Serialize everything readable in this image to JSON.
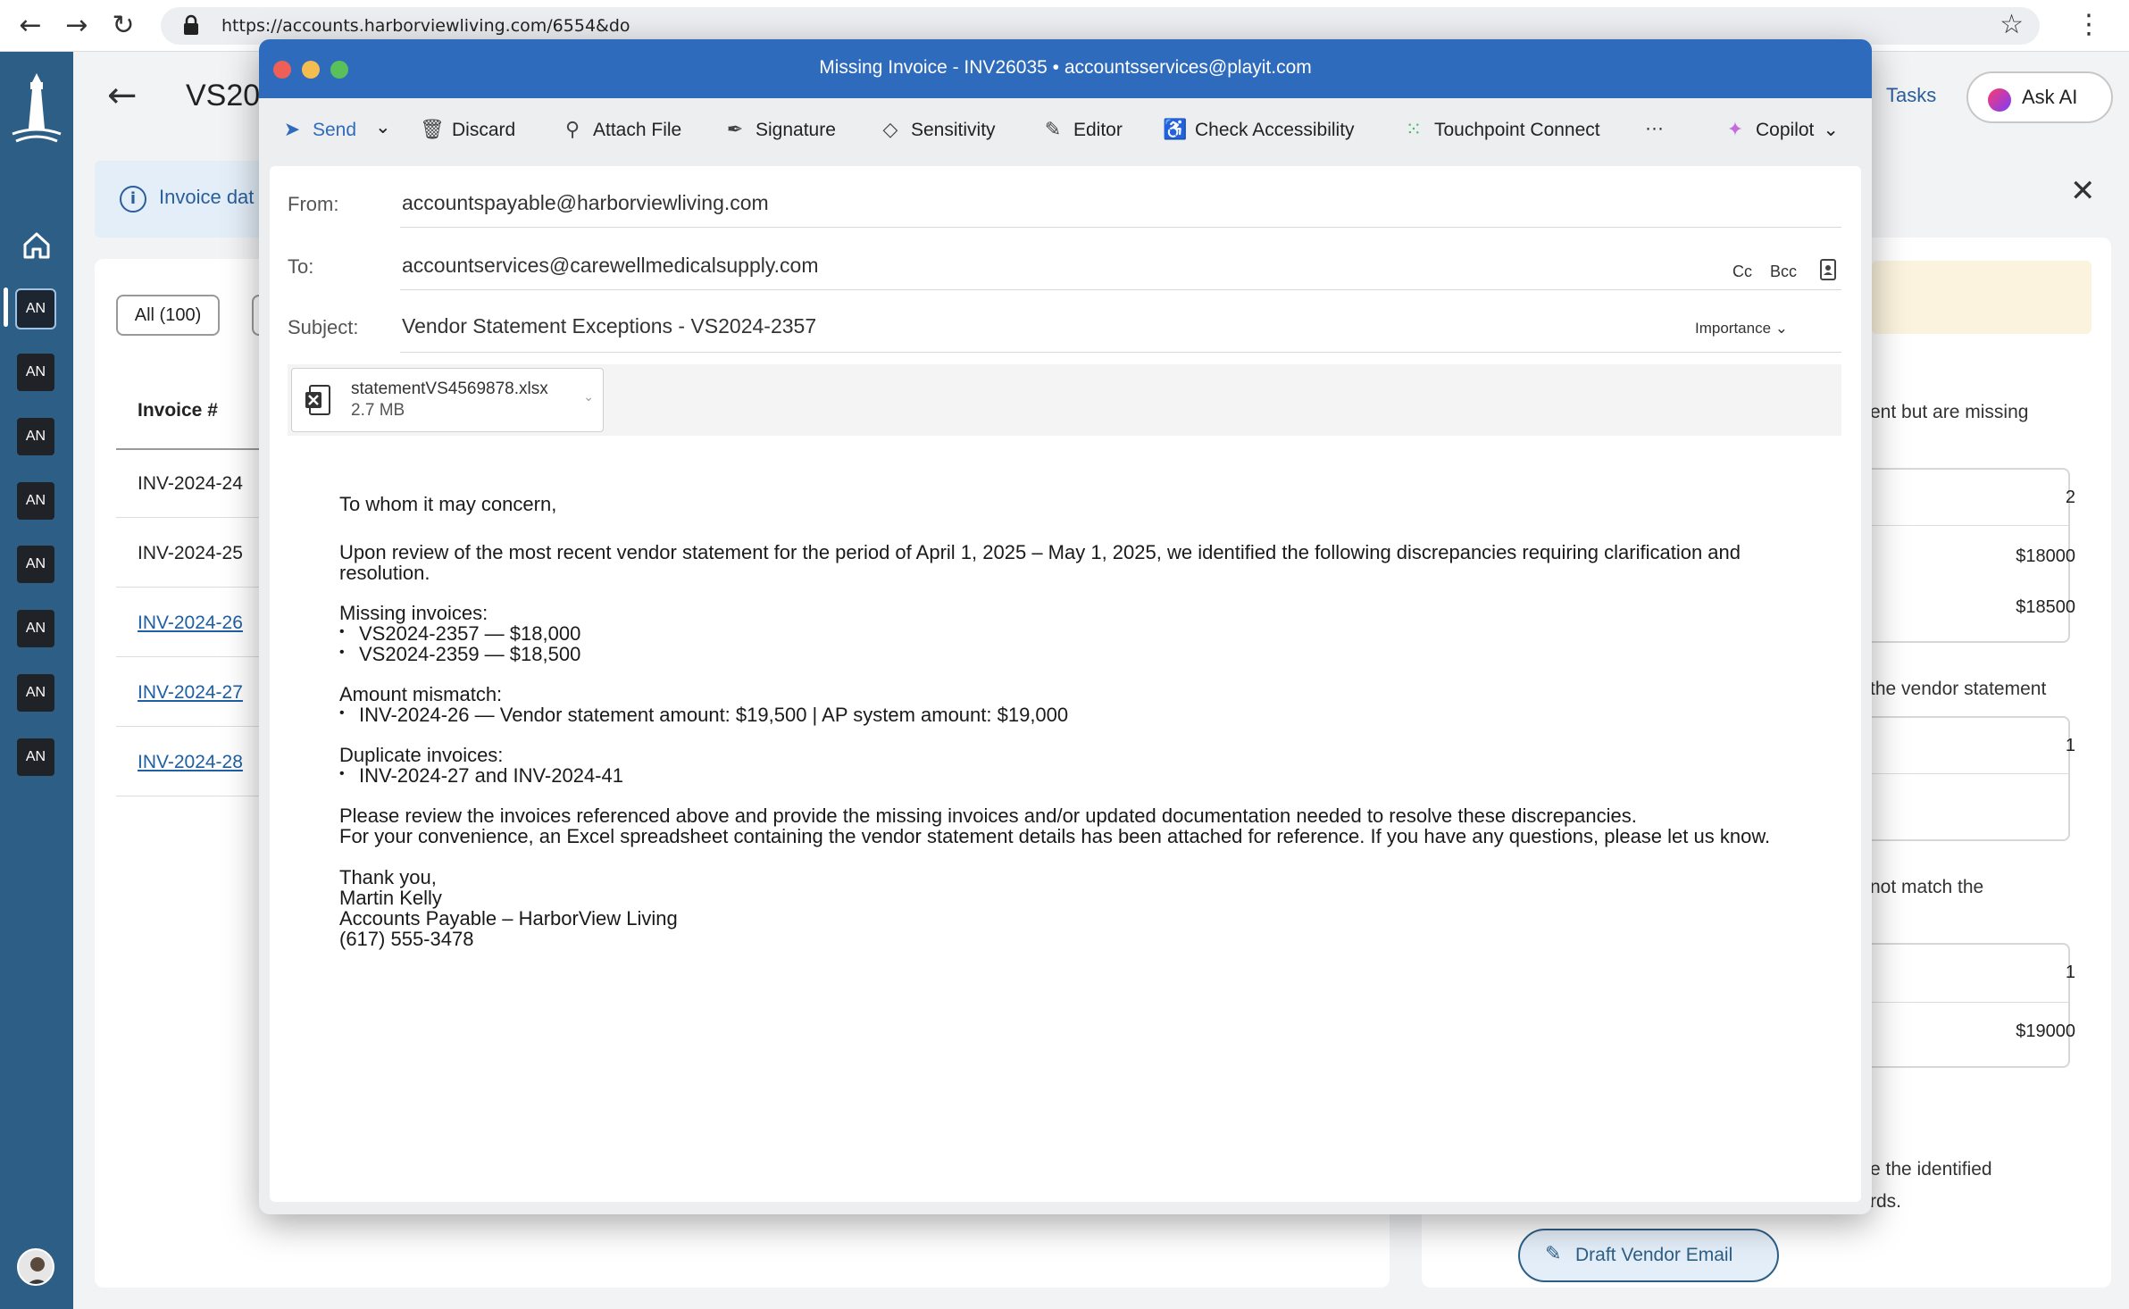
{
  "browser": {
    "url": "https://accounts.harborviewliving.com/6554&do",
    "back": "←",
    "forward": "→",
    "reload": "↻",
    "star": "☆",
    "menu": "⋮"
  },
  "sidebar": {
    "items": [
      "AN",
      "AN",
      "AN",
      "AN",
      "AN",
      "AN",
      "AN",
      "AN"
    ]
  },
  "page": {
    "back": "←",
    "title": "VS20",
    "tasks": "Tasks",
    "ask_ai": "Ask AI",
    "info_text": "Invoice dat",
    "filter_all": "All (100)",
    "column_invoice": "Invoice #",
    "invoices": [
      "INV-2024-24",
      "INV-2024-25",
      "INV-2024-26",
      "INV-2024-27",
      "INV-2024-28"
    ],
    "close": "✕"
  },
  "right_panel": {
    "text1": "ent but are missing",
    "box1": {
      "count": "2",
      "amount1": "$18000",
      "amount2": "$18500"
    },
    "text2": "the vendor statement",
    "box2": {
      "count": "1"
    },
    "text3": "not match the",
    "box3": {
      "count": "1",
      "amount": "$19000"
    },
    "text4a": "e the identified",
    "text4b": "rds.",
    "draft_button": "Draft Vendor Email"
  },
  "compose": {
    "title": "Missing Invoice - INV26035  •  accountsservices@playit.com",
    "toolbar": {
      "send": "Send",
      "discard": "Discard",
      "attach": "Attach File",
      "signature": "Signature",
      "sensitivity": "Sensitivity",
      "editor": "Editor",
      "accessibility": "Check Accessibility",
      "touchpoint": "Touchpoint Connect",
      "more": "···",
      "copilot": "Copilot"
    },
    "from_label": "From:",
    "from_value": "accountspayable@harborviewliving.com",
    "to_label": "To:",
    "to_value": "accountservices@carewellmedicalsupply.com",
    "cc": "Cc",
    "bcc": "Bcc",
    "subject_label": "Subject:",
    "subject_value": "Vendor Statement Exceptions -  VS2024-2357",
    "importance": "Importance",
    "attachment": {
      "name": "statementVS4569878.xlsx",
      "size": "2.7 MB"
    },
    "body": {
      "greeting": "To whom it may concern,",
      "intro1": "Upon review of the most recent vendor statement for the period of April 1, 2025 – May 1, 2025, we identified the following discrepancies requiring clarification and",
      "intro2": "resolution.",
      "missing_heading": "Missing invoices:",
      "missing_items": [
        "VS2024-2357 — $18,000",
        "VS2024-2359 — $18,500"
      ],
      "mismatch_heading": "Amount mismatch:",
      "mismatch_items": [
        "INV-2024-26 — Vendor statement amount: $19,500 | AP system amount: $19,000"
      ],
      "duplicate_heading": "Duplicate invoices:",
      "duplicate_items": [
        "INV-2024-27 and INV-2024-41"
      ],
      "closing1": "Please review the invoices referenced above and provide the missing invoices and/or updated documentation needed to resolve these discrepancies.",
      "closing2": "For your convenience, an Excel spreadsheet containing the vendor statement details has been attached for reference. If you have any questions, please let us know.",
      "signoff": "Thank you,",
      "sig_name": "Martin Kelly",
      "sig_title": "Accounts Payable – HarborView Living",
      "sig_phone": "(617) 555-3478"
    }
  }
}
